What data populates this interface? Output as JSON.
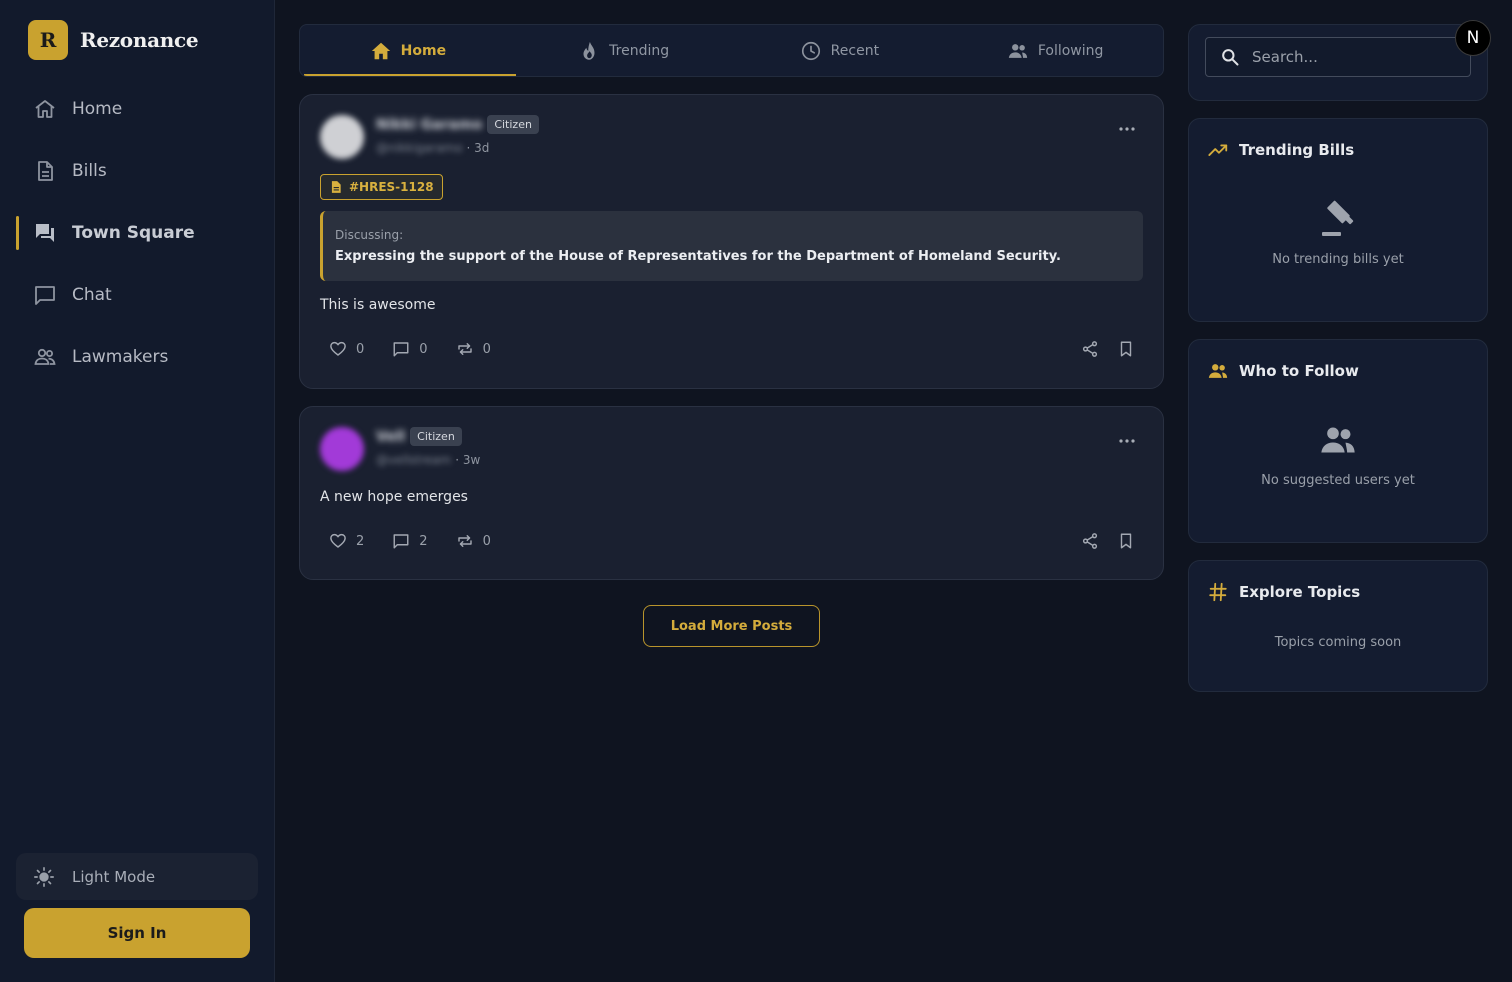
{
  "app": {
    "logo_letter": "R",
    "name": "Rezonance"
  },
  "sidebar": {
    "items": [
      {
        "label": "Home",
        "icon": "home-icon",
        "active": false
      },
      {
        "label": "Bills",
        "icon": "document-icon",
        "active": false
      },
      {
        "label": "Town Square",
        "icon": "forum-icon",
        "active": true
      },
      {
        "label": "Chat",
        "icon": "chat-icon",
        "active": false
      },
      {
        "label": "Lawmakers",
        "icon": "people-icon",
        "active": false
      }
    ],
    "theme_toggle_label": "Light Mode",
    "signin_label": "Sign In"
  },
  "tabs": [
    {
      "label": "Home",
      "icon": "home-icon",
      "active": true
    },
    {
      "label": "Trending",
      "icon": "fire-icon",
      "active": false
    },
    {
      "label": "Recent",
      "icon": "clock-icon",
      "active": false
    },
    {
      "label": "Following",
      "icon": "people-icon",
      "active": false
    }
  ],
  "posts": [
    {
      "author": "Nikki Garamo",
      "handle": "@nikkigaramo",
      "role": "Citizen",
      "time": "· 3d",
      "bill_tag": "#HRES-1128",
      "discussing_label": "Discussing:",
      "discussing_title": "Expressing the support of the House of Representatives for the Department of Homeland Security.",
      "text": "This is awesome",
      "likes": "0",
      "comments": "0",
      "reposts": "0"
    },
    {
      "author": "Vell",
      "handle": "@vellstream",
      "role": "Citizen",
      "time": "· 3w",
      "text": "A new hope emerges",
      "likes": "2",
      "comments": "2",
      "reposts": "0"
    }
  ],
  "load_more_label": "Load More Posts",
  "search": {
    "placeholder": "Search..."
  },
  "trending_bills": {
    "title": "Trending Bills",
    "empty_text": "No trending bills yet"
  },
  "who_to_follow": {
    "title": "Who to Follow",
    "empty_text": "No suggested users yet"
  },
  "explore_topics": {
    "title": "Explore Topics",
    "empty_text": "Topics coming soon"
  },
  "floating_badge": "N",
  "colors": {
    "accent": "#c9a22f",
    "background": "#0f1420",
    "card": "#1a2030",
    "panel": "#141c30"
  }
}
